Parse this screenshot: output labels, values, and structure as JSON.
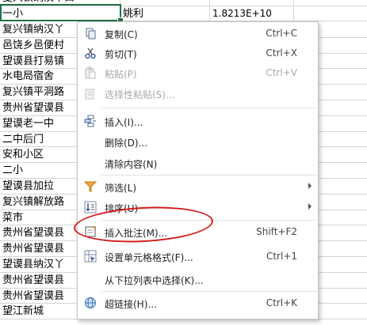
{
  "sheet": {
    "rows": [
      {
        "a": "夏兴镇纳汉丫口",
        "b": "",
        "c": "",
        "d": ""
      },
      {
        "a": "一小",
        "b": "姚利",
        "c": "1.8213E+10",
        "d": ""
      },
      {
        "a": "复兴镇纳汉丫",
        "b": "",
        "c": "",
        "d": ""
      },
      {
        "a": "邑饶乡邑便村",
        "b": "",
        "c": "",
        "d": ""
      },
      {
        "a": "望谟县打易镇",
        "b": "",
        "c": "",
        "d": ""
      },
      {
        "a": "水电局宿舍",
        "b": "",
        "c": "",
        "d": ""
      },
      {
        "a": "复兴镇平洞路",
        "b": "",
        "c": "",
        "d": ""
      },
      {
        "a": "贵州省望谟县",
        "b": "",
        "c": "",
        "d": ""
      },
      {
        "a": "望谟老一中",
        "b": "",
        "c": "",
        "d": ""
      },
      {
        "a": "二中后门",
        "b": "",
        "c": "",
        "d": ""
      },
      {
        "a": "安和小区",
        "b": "",
        "c": "",
        "d": ""
      },
      {
        "a": "二小",
        "b": "",
        "c": "",
        "d": ""
      },
      {
        "a": "望谟县加拉",
        "b": "",
        "c": "",
        "d": ""
      },
      {
        "a": "复兴镇解放路",
        "b": "",
        "c": "",
        "d": ""
      },
      {
        "a": "菜市",
        "b": "",
        "c": "",
        "d": ""
      },
      {
        "a": "贵州省望谟县",
        "b": "",
        "c": "",
        "d": ""
      },
      {
        "a": "贵州省望谟县",
        "b": "",
        "c": "",
        "d": ""
      },
      {
        "a": "望谟县纳汉丫",
        "b": "",
        "c": "",
        "d": ""
      },
      {
        "a": "贵州省望谟县",
        "b": "",
        "c": "",
        "d": ""
      },
      {
        "a": "贵州省望谟县",
        "b": "",
        "c": "",
        "d": ""
      },
      {
        "a": "望江新城",
        "b": "",
        "c": "",
        "d": ""
      }
    ]
  },
  "context_menu": {
    "items": [
      {
        "label": "复制(C)",
        "shortcut": "Ctrl+C",
        "icon": "copy-icon",
        "disabled": false,
        "submenu": false
      },
      {
        "label": "剪切(T)",
        "shortcut": "Ctrl+X",
        "icon": "scissors-icon",
        "disabled": false,
        "submenu": false
      },
      {
        "label": "粘贴(P)",
        "shortcut": "Ctrl+V",
        "icon": "paste-icon",
        "disabled": true,
        "submenu": false
      },
      {
        "label": "选择性粘贴(S)...",
        "shortcut": "",
        "icon": "paste-special-icon",
        "disabled": true,
        "submenu": false
      },
      {
        "label": "插入(I)...",
        "shortcut": "",
        "icon": "insert-cells-icon",
        "disabled": false,
        "submenu": false
      },
      {
        "label": "删除(D)...",
        "shortcut": "",
        "icon": "",
        "disabled": false,
        "submenu": false
      },
      {
        "label": "清除内容(N)",
        "shortcut": "",
        "icon": "",
        "disabled": false,
        "submenu": false
      },
      {
        "label": "筛选(L)",
        "shortcut": "",
        "icon": "filter-icon",
        "disabled": false,
        "submenu": true
      },
      {
        "label": "排序(U)",
        "shortcut": "",
        "icon": "sort-icon",
        "disabled": false,
        "submenu": true
      },
      {
        "label": "插入批注(M)...",
        "shortcut": "Shift+F2",
        "icon": "insert-comment-icon",
        "disabled": false,
        "submenu": false
      },
      {
        "label": "设置单元格格式(F)...",
        "shortcut": "Ctrl+1",
        "icon": "format-cells-icon",
        "disabled": false,
        "submenu": false
      },
      {
        "label": "从下拉列表中选择(K)...",
        "shortcut": "",
        "icon": "",
        "disabled": false,
        "submenu": false
      },
      {
        "label": "超链接(H)...",
        "shortcut": "Ctrl+K",
        "icon": "hyperlink-icon",
        "disabled": false,
        "submenu": false
      }
    ]
  },
  "colors": {
    "selection": "#217346",
    "highlight_oval": "#d21c1c"
  }
}
